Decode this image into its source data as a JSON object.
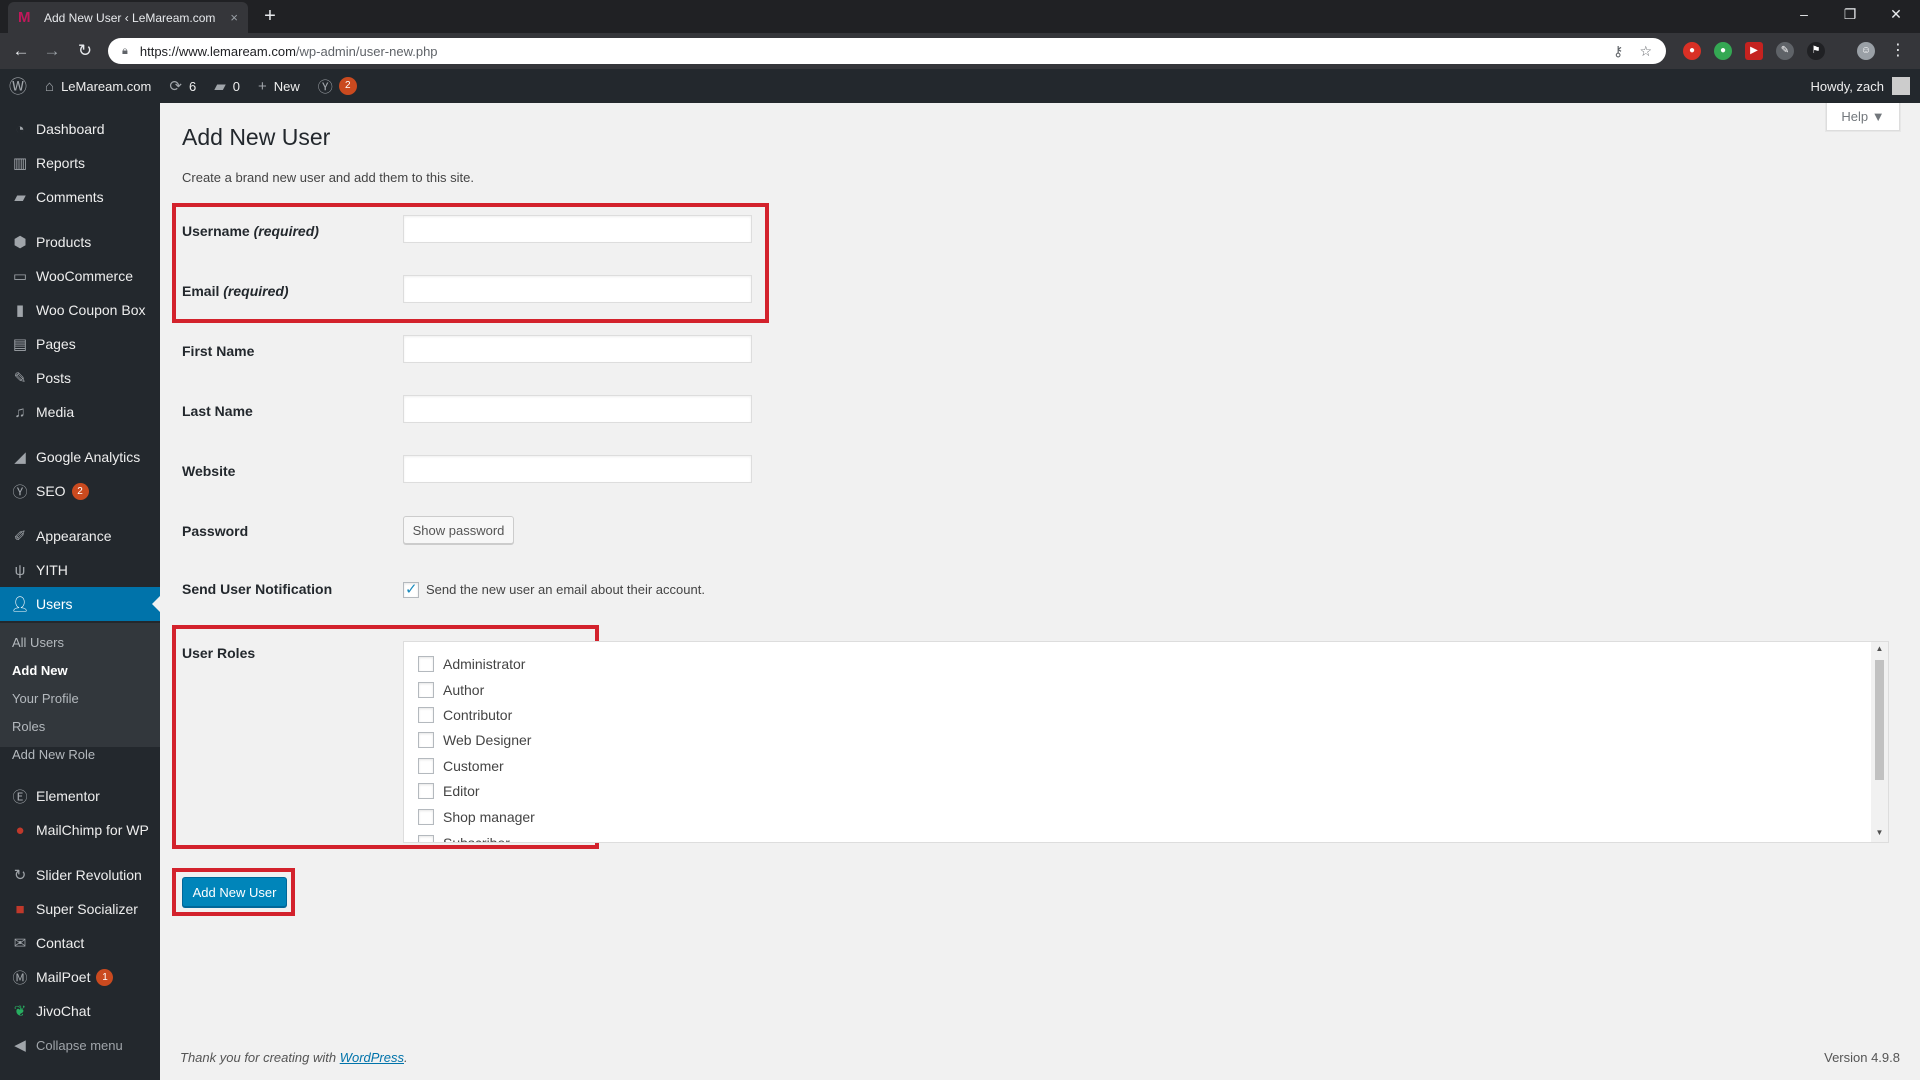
{
  "browser": {
    "tab_title": "Add New User ‹ LeMaream.com",
    "tab_favicon": "M",
    "tab_close": "×",
    "new_tab": "+",
    "url_host": "https://www.lemaream.com",
    "url_path": "/wp-admin/user-new.php",
    "window_minimize": "–",
    "window_restore": "❐",
    "window_close": "✕"
  },
  "adminbar": {
    "site_name": "LeMaream.com",
    "updates_count": "6",
    "comments_count": "0",
    "new_label": "New",
    "seo_badge": "2",
    "howdy": "Howdy, zach"
  },
  "sidebar": {
    "items": [
      {
        "label": "Dashboard",
        "icon": "dashboard-icon"
      },
      {
        "label": "Reports",
        "icon": "bar-chart-icon"
      },
      {
        "label": "Comments",
        "icon": "speech-bubble-icon"
      },
      {
        "label": "Products",
        "icon": "box-icon"
      },
      {
        "label": "WooCommerce",
        "icon": "woo-icon"
      },
      {
        "label": "Woo Coupon Box",
        "icon": "coupon-icon"
      },
      {
        "label": "Pages",
        "icon": "page-icon"
      },
      {
        "label": "Posts",
        "icon": "pin-icon"
      },
      {
        "label": "Media",
        "icon": "media-icon"
      },
      {
        "label": "Google Analytics",
        "icon": "analytics-icon"
      },
      {
        "label": "SEO",
        "icon": "yoast-icon",
        "badge": "2"
      },
      {
        "label": "Appearance",
        "icon": "brush-icon"
      },
      {
        "label": "YITH",
        "icon": "yith-icon"
      },
      {
        "label": "Users",
        "icon": "user-icon"
      },
      {
        "label": "Elementor",
        "icon": "elementor-icon"
      },
      {
        "label": "MailChimp for WP",
        "icon": "mailchimp-icon"
      },
      {
        "label": "Slider Revolution",
        "icon": "refresh-icon"
      },
      {
        "label": "Super Socializer",
        "icon": "socializer-icon"
      },
      {
        "label": "Contact",
        "icon": "envelope-icon"
      },
      {
        "label": "MailPoet",
        "icon": "mailpoet-icon",
        "badge": "1"
      },
      {
        "label": "JivoChat",
        "icon": "leaf-icon"
      },
      {
        "label": "Collapse menu",
        "icon": "collapse-icon"
      }
    ],
    "submenu": [
      "All Users",
      "Add New",
      "Your Profile",
      "Roles",
      "Add New Role"
    ]
  },
  "content": {
    "help": "Help ▼",
    "title": "Add New User",
    "description": "Create a brand new user and add them to this site.",
    "fields": {
      "username_label": "Username",
      "email_label": "Email",
      "required_note": "(required)",
      "first_name_label": "First Name",
      "last_name_label": "Last Name",
      "website_label": "Website",
      "password_label": "Password",
      "show_password": "Show password",
      "notification_label": "Send User Notification",
      "notification_text": "Send the new user an email about their account.",
      "notification_checked": true,
      "roles_label": "User Roles"
    },
    "roles": [
      "Administrator",
      "Author",
      "Contributor",
      "Web Designer",
      "Customer",
      "Editor",
      "Shop manager",
      "Subscriber"
    ],
    "submit": "Add New User"
  },
  "footer": {
    "thanks_prefix": "Thank you for creating with",
    "thanks_link": "WordPress",
    "thanks_suffix": ".",
    "version": "Version 4.9.8"
  },
  "colors": {
    "highlight": "#d3222c",
    "primary": "#0085ba",
    "sidebar_bg": "#23282d",
    "current_menu": "#0073aa"
  }
}
